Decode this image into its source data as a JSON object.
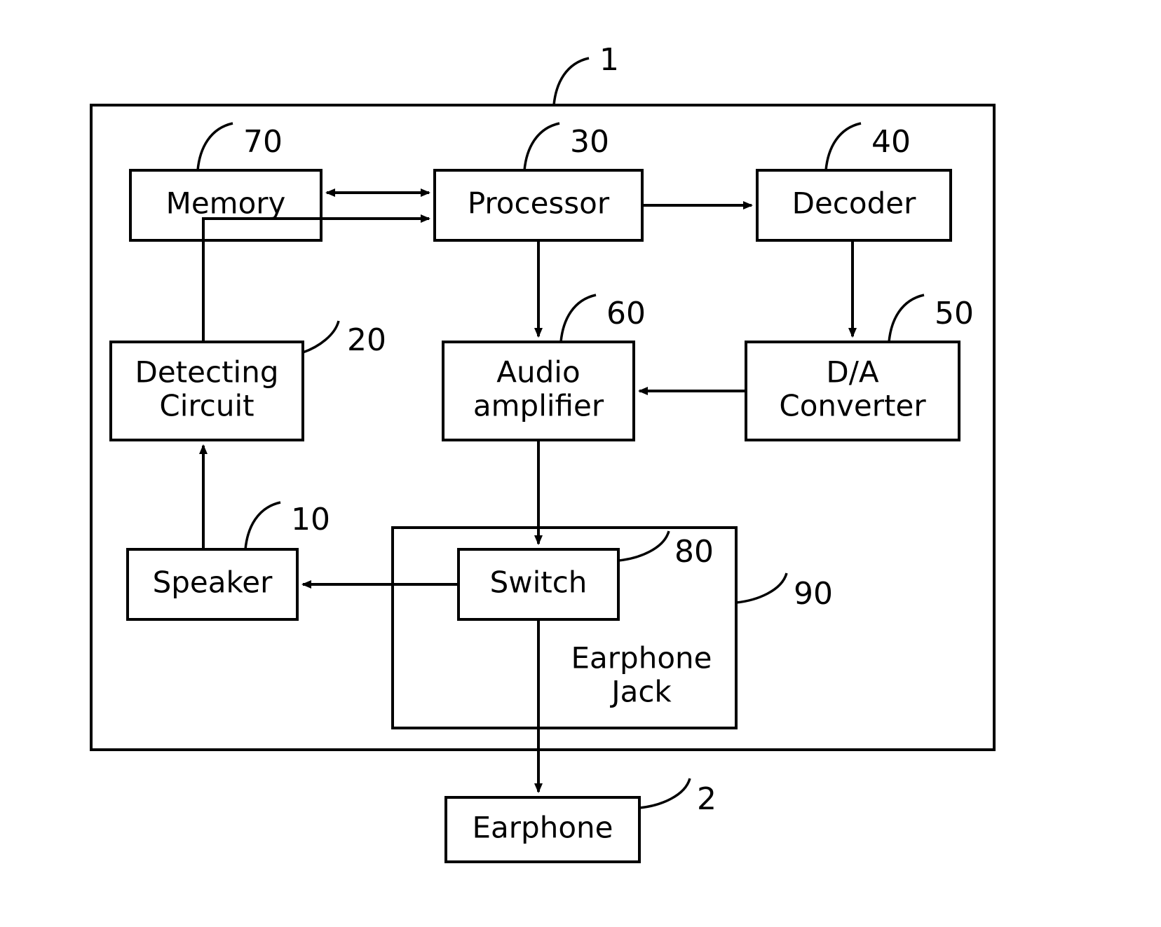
{
  "diagram": {
    "outer_ref": "1",
    "earphone_ref": "2",
    "blocks": {
      "memory": {
        "label": "Memory",
        "ref": "70"
      },
      "processor": {
        "label": "Processor",
        "ref": "30"
      },
      "decoder": {
        "label": "Decoder",
        "ref": "40"
      },
      "detecting": {
        "label1": "Detecting",
        "label2": "Circuit",
        "ref": "20"
      },
      "audio": {
        "label1": "Audio",
        "label2": "amplifier",
        "ref": "60"
      },
      "dac": {
        "label1": "D/A",
        "label2": "Converter",
        "ref": "50"
      },
      "speaker": {
        "label": "Speaker",
        "ref": "10"
      },
      "switch": {
        "label": "Switch",
        "ref": "80"
      },
      "jack": {
        "label1": "Earphone",
        "label2": "Jack",
        "ref": "90"
      },
      "earphone": {
        "label": "Earphone"
      }
    }
  }
}
